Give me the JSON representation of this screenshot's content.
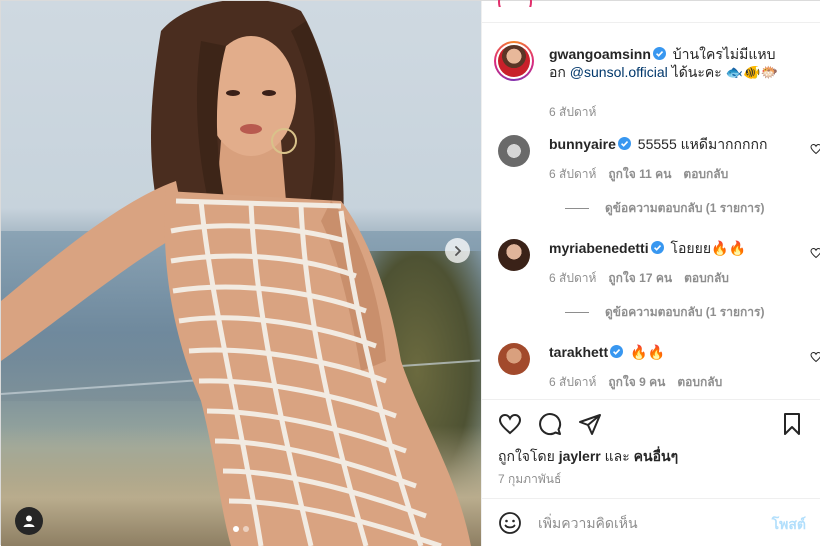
{
  "photo": {
    "carousel_dots": 2,
    "active_dot": 0,
    "next_icon": "chevron-right-icon",
    "tag_icon": "user-tag-icon"
  },
  "caption": {
    "username": "gwangoamsinn",
    "text": "บ้านใครไม่มีแหบอก",
    "mention": "@sunsol.official",
    "suffix": "ได้นะคะ 🐟🐠🐡",
    "time": "6 สัปดาห์"
  },
  "comments": [
    {
      "username": "bunnyaire",
      "text": "55555 แหดีมากกกกก",
      "time": "6 สัปดาห์",
      "likes": "ถูกใจ 11 คน",
      "reply": "ตอบกลับ",
      "view_replies": "ดูข้อความตอบกลับ (1 รายการ)"
    },
    {
      "username": "myriabenedetti",
      "text": "โอยยย🔥🔥",
      "time": "6 สัปดาห์",
      "likes": "ถูกใจ 17 คน",
      "reply": "ตอบกลับ",
      "view_replies": "ดูข้อความตอบกลับ (1 รายการ)"
    },
    {
      "username": "tarakhett",
      "text": "🔥🔥",
      "time": "6 สัปดาห์",
      "likes": "ถูกใจ 9 คน",
      "reply": "ตอบกลับ"
    }
  ],
  "actions": {
    "liked_by_prefix": "ถูกใจโดย",
    "liked_by_user": "jaylerr",
    "liked_by_and": "และ",
    "liked_by_others": "คนอื่นๆ",
    "date": "7 กุมภาพันธ์"
  },
  "add_comment": {
    "placeholder": "เพิ่มความคิดเห็น",
    "post_label": "โพสต์"
  },
  "colors": {
    "verified": "#3897f0",
    "mention": "#00376b",
    "post_disabled": "#b2dffc",
    "muted": "#8e8e8e"
  }
}
